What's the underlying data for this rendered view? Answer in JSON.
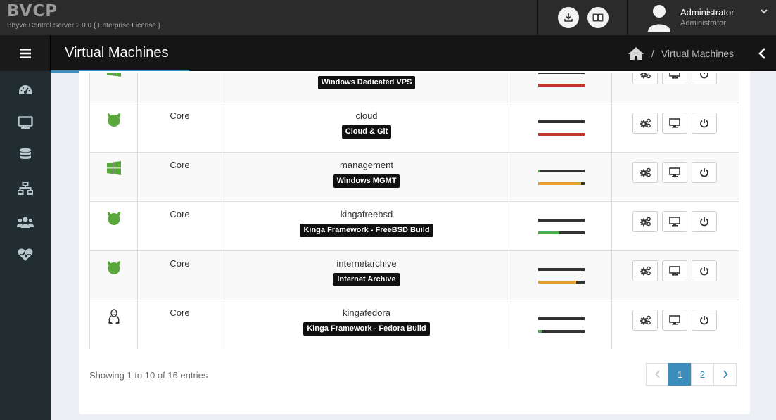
{
  "app": {
    "brand": "BVCP",
    "subtitle": "Bhyve Control Server 2.0.0 { Enterprise License }"
  },
  "top_icons": [
    "download-icon",
    "language-icon"
  ],
  "user": {
    "name": "Administrator",
    "role": "Administrator"
  },
  "header": {
    "title": "Virtual Machines",
    "breadcrumb": {
      "home_icon": "home-icon",
      "current": "Virtual Machines"
    }
  },
  "sidebar": {
    "items": [
      {
        "icon": "dashboard-icon"
      },
      {
        "icon": "monitor-icon"
      },
      {
        "icon": "database-icon"
      },
      {
        "icon": "network-icon"
      },
      {
        "icon": "users-icon"
      },
      {
        "icon": "heartbeat-icon"
      }
    ]
  },
  "vms": [
    {
      "os": "windows",
      "type": "",
      "name": "",
      "description": "Windows Dedicated VPS",
      "bar1": 0,
      "bar2": 1.0,
      "bar1_color": "#333333",
      "bar2_color": "#c0392b"
    },
    {
      "os": "freebsd",
      "type": "Core",
      "name": "cloud",
      "description": "Cloud & Git",
      "bar1": 0,
      "bar2": 1.0,
      "bar1_color": "#333333",
      "bar2_color": "#c0392b"
    },
    {
      "os": "windows",
      "type": "Core",
      "name": "management",
      "description": "Windows MGMT",
      "bar1": 0.05,
      "bar2": 0.92,
      "bar1_color": "#4cae4c",
      "bar2_color": "#e0a030"
    },
    {
      "os": "freebsd",
      "type": "Core",
      "name": "kingafreebsd",
      "description": "Kinga Framework - FreeBSD Build",
      "bar1": 0,
      "bar2": 0.45,
      "bar1_color": "#333333",
      "bar2_color": "#4cae4c"
    },
    {
      "os": "freebsd",
      "type": "Core",
      "name": "internetarchive",
      "description": "Internet Archive",
      "bar1": 0,
      "bar2": 0.82,
      "bar1_color": "#333333",
      "bar2_color": "#e0a030"
    },
    {
      "os": "linux",
      "type": "Core",
      "name": "kingafedora",
      "description": "Kinga Framework - Fedora Build",
      "bar1": 0,
      "bar2": 0.08,
      "bar1_color": "#333333",
      "bar2_color": "#4cae4c"
    }
  ],
  "row_actions": [
    "settings-icon",
    "console-icon",
    "power-icon"
  ],
  "footer": {
    "showing": "Showing 1 to 10 of 16 entries",
    "pages": [
      "1",
      "2"
    ],
    "active_page": "1"
  },
  "colors": {
    "accent": "#3c8dbc",
    "os_icon": "#5aa83c",
    "sidebar_bg": "#222d32"
  }
}
